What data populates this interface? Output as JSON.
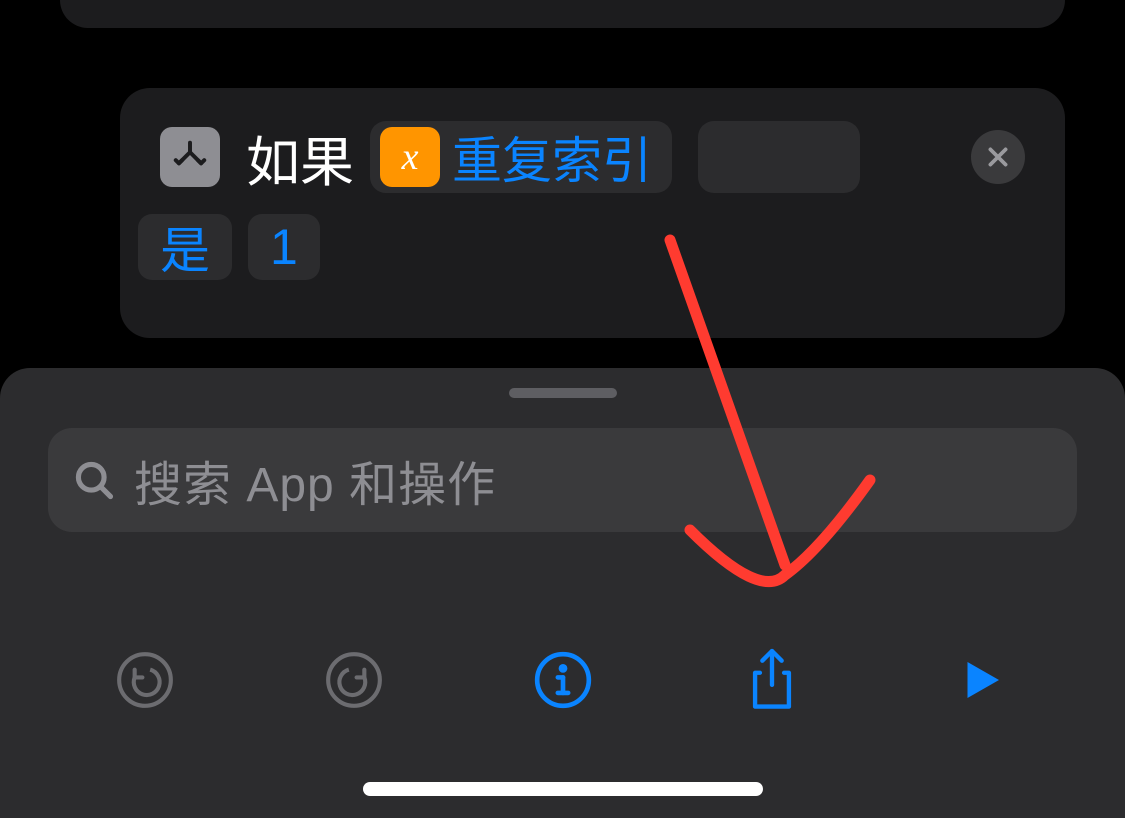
{
  "action": {
    "if_label": "如果",
    "variable_label": "重复索引",
    "variable_icon_label": "x",
    "condition": "是",
    "value": "1"
  },
  "search": {
    "placeholder": "搜索 App 和操作"
  },
  "colors": {
    "accent": "#0a84ff",
    "orange": "#ff9500"
  }
}
